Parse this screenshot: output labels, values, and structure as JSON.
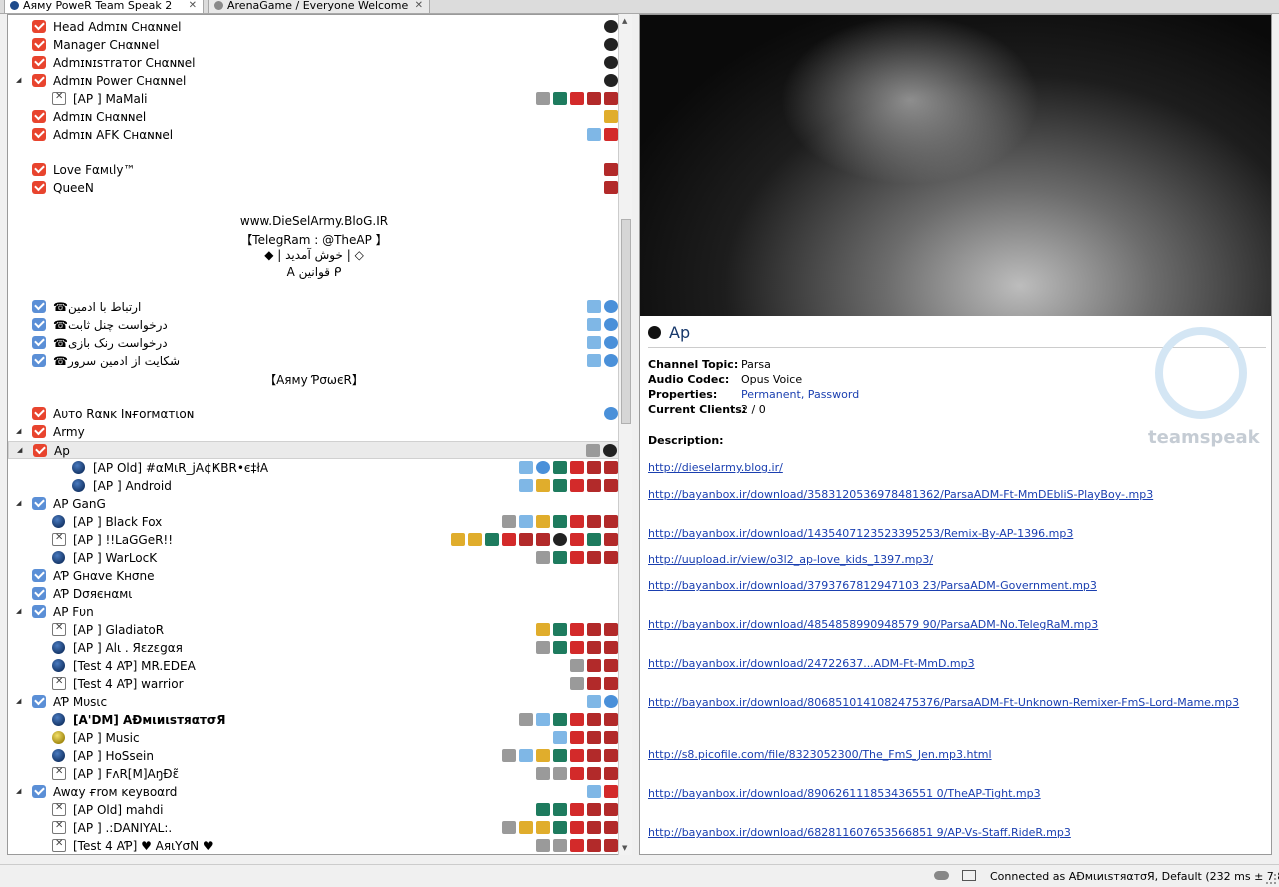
{
  "tabs": [
    {
      "label": "Aямy PoweR Team Speak 2",
      "close": "✕"
    },
    {
      "label": "ArenaGame / Everyone Welcome",
      "close": "✕"
    }
  ],
  "tree": {
    "rows": [
      {
        "kind": "chan",
        "label": "Head Admɪɴ Cнαɴɴel"
      },
      {
        "kind": "chan",
        "label": "Manager Cнαɴɴel"
      },
      {
        "kind": "chan",
        "label": "Admɪɴɪѕтraтor Cнαɴɴel"
      },
      {
        "kind": "chan",
        "label": "Admɪɴ Power Cнαɴɴel",
        "expander": "◢"
      },
      {
        "kind": "client",
        "label": "[AP ] MaMali",
        "status": "muted"
      },
      {
        "kind": "chan",
        "label": "Admɪɴ Cнαɴɴel"
      },
      {
        "kind": "chan",
        "label": "Admɪɴ AFK Cнαɴɴel"
      },
      {
        "kind": "chan",
        "label": "Love Fαмιly™"
      },
      {
        "kind": "chan",
        "label": "QueeN"
      },
      {
        "kind": "center",
        "label": "www.DieSelArmy.BloG.IR"
      },
      {
        "kind": "center",
        "label": "【TelegRam : @TheAP 】"
      },
      {
        "kind": "center",
        "label": "◆  | خوش آمدید  |  ◇"
      },
      {
        "kind": "center",
        "label": "A قوانین ᑭ"
      },
      {
        "kind": "chan",
        "label": "☎ارتباط با ادمین",
        "blue": true
      },
      {
        "kind": "chan",
        "label": "☎درخواست چنل ثابت",
        "blue": true
      },
      {
        "kind": "chan",
        "label": "☎درخواست رنک بازی",
        "blue": true
      },
      {
        "kind": "chan",
        "label": "☎شکایت از ادمین سرور",
        "blue": true
      },
      {
        "kind": "center",
        "label": "【Aямy ƤσωєR】"
      },
      {
        "kind": "chan",
        "label": "Aυтo Rαɴĸ Iɴғorмαтιoɴ"
      },
      {
        "kind": "chan",
        "label": "Army",
        "expander": "◢"
      },
      {
        "kind": "chan",
        "label": "Ap",
        "expander": "◢",
        "selected": true
      },
      {
        "kind": "client",
        "label": "[AP Old] #αMιR_jA¢ҜBR•є‡łA"
      },
      {
        "kind": "client",
        "label": "[AP ] Android"
      },
      {
        "kind": "chan",
        "label": "AP GanG",
        "blue": true,
        "expander": "◢"
      },
      {
        "kind": "client",
        "label": "[AP ] Black Fox"
      },
      {
        "kind": "client",
        "label": "[AP ] !!LaGGeR!!",
        "status": "muted"
      },
      {
        "kind": "client",
        "label": "[AP ] WarLocK"
      },
      {
        "kind": "chan",
        "label": "AƤ Gнαve Kнσne",
        "blue": true
      },
      {
        "kind": "chan",
        "label": "AƤ Dσяєнαмι",
        "blue": true
      },
      {
        "kind": "chan",
        "label": "AP Fυn",
        "blue": true,
        "expander": "◢"
      },
      {
        "kind": "client",
        "label": "[AP ] GladiatoR",
        "status": "muted"
      },
      {
        "kind": "client",
        "label": "[AP ] Alι . Яεzεgαя"
      },
      {
        "kind": "client",
        "label": "[Test 4 AƤ] MR.EDEA"
      },
      {
        "kind": "client",
        "label": "[Test 4 AƤ] warrior",
        "status": "muted"
      },
      {
        "kind": "chan",
        "label": "AƤ Mυѕιc",
        "blue": true,
        "expander": "◢"
      },
      {
        "kind": "client",
        "label": "[A'DM] AĐмιиιѕтяαтσЯ",
        "bold": true
      },
      {
        "kind": "client",
        "label": "[AP ] Music",
        "yellow": true
      },
      {
        "kind": "client",
        "label": "[AP ] HoSsein"
      },
      {
        "kind": "client",
        "label": "[AP ] FʌR[M]AŋĐɛ̃",
        "status": "muted"
      },
      {
        "kind": "chan",
        "label": "Awαy ғroм ĸeyвoαrd",
        "blue": true,
        "expander": "◢"
      },
      {
        "kind": "client",
        "label": "[AP Old] mahdi",
        "status": "muted"
      },
      {
        "kind": "client",
        "label": "[AP ] .:DANIYAL:.",
        "status": "muted"
      },
      {
        "kind": "client",
        "label": "[Test 4 AƤ] ♥ AяιYσN ♥",
        "status": "muted"
      }
    ]
  },
  "info": {
    "title": "Ap",
    "fields": [
      {
        "key": "Channel Topic:",
        "value": "Parsa"
      },
      {
        "key": "Audio Codec:",
        "value": "Opus Voice"
      },
      {
        "key": "Properties:",
        "value": "Permanent, Password"
      },
      {
        "key": "Current Clients:",
        "value": "2 / 0"
      }
    ],
    "description_label": "Description:",
    "links": [
      "http://dieselarmy.blog.ir/",
      "http://bayanbox.ir/download/3583120536978481362/ParsaADM-Ft-MmDEbliS-PlayBoy-.mp3",
      "http://bayanbox.ir/download/1435407123523395253/Remix-By-AP-1396.mp3",
      "http://uupload.ir/view/o3l2_ap-love_kids_1397.mp3/",
      "http://bayanbox.ir/download/3793767812947103 23/ParsaADM-Government.mp3",
      "http://bayanbox.ir/download/4854858990948579 90/ParsaADM-No.TelegRaM.mp3",
      "http://bayanbox.ir/download/24722637...ADM-Ft-MmD.mp3",
      "http://bayanbox.ir/download/8068510141082475376/ParsaADM-Ft-Unknown-Remixer-FmS-Lord-Mame.mp3",
      "http://s8.picofile.com/file/8323052300/The_FmS_Jen.mp3.html",
      "http://bayanbox.ir/download/890626111853436551 0/TheAP-Tight.mp3",
      "http://bayanbox.ir/download/682811607653566851 9/AP-Vs-Staff.RideR.mp3"
    ],
    "logo_text": "teamspeak"
  },
  "status": {
    "message": "Connected as AĐмιиιѕтяαтσЯ, Default (232 ms ± 7.8)"
  }
}
